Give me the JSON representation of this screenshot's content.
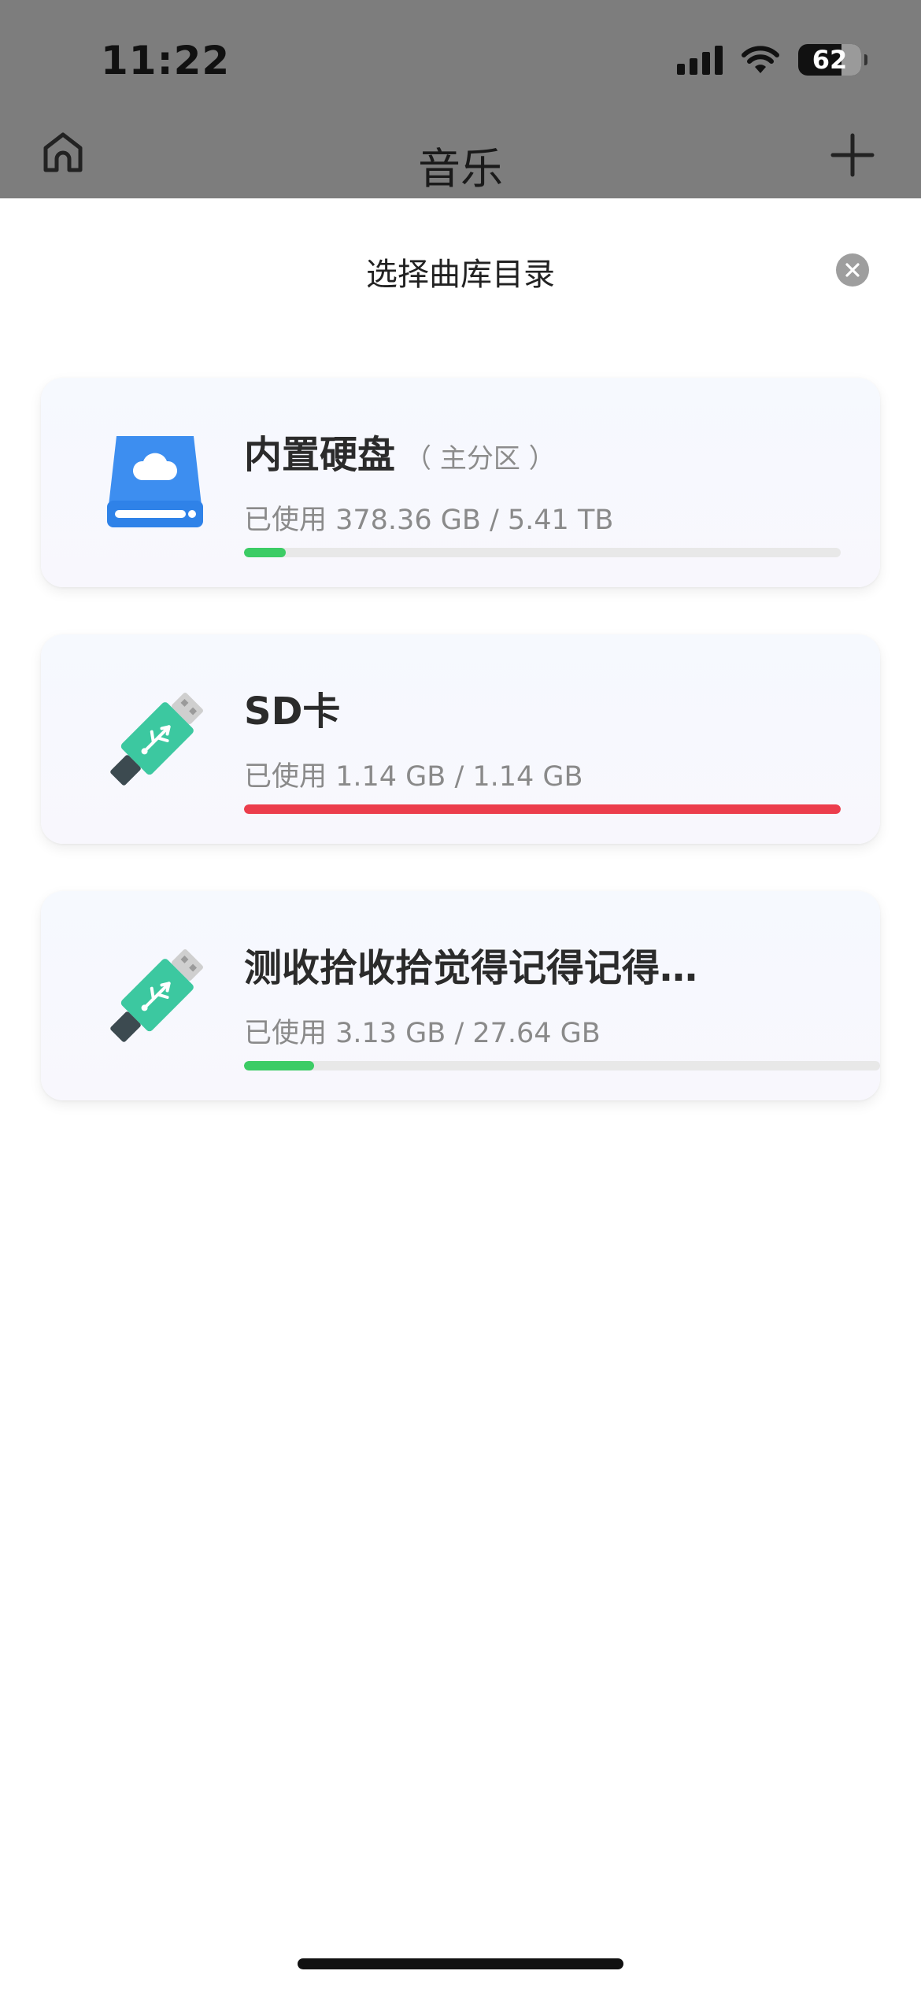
{
  "status_bar": {
    "time": "11:22",
    "battery": "62"
  },
  "header": {
    "title": "音乐"
  },
  "sheet": {
    "title": "选择曲库目录",
    "drives": [
      {
        "name": "内置硬盘",
        "sub": "（ 主分区 ）",
        "usage": "已使用 378.36 GB / 5.41 TB",
        "used_fraction": 0.07,
        "bar_color": "#3ccc65",
        "icon": "hard-drive-cloud-icon"
      },
      {
        "name": "SD卡",
        "sub": "",
        "usage": "已使用 1.14 GB / 1.14 GB",
        "used_fraction": 1.0,
        "bar_color": "#ec3d4c",
        "icon": "usb-drive-icon"
      },
      {
        "name": "测收拾收拾觉得记得记得…",
        "sub": "",
        "usage": "已使用 3.13 GB / 27.64 GB",
        "used_fraction": 0.11,
        "bar_color": "#3ccc65",
        "icon": "usb-drive-icon"
      }
    ]
  }
}
